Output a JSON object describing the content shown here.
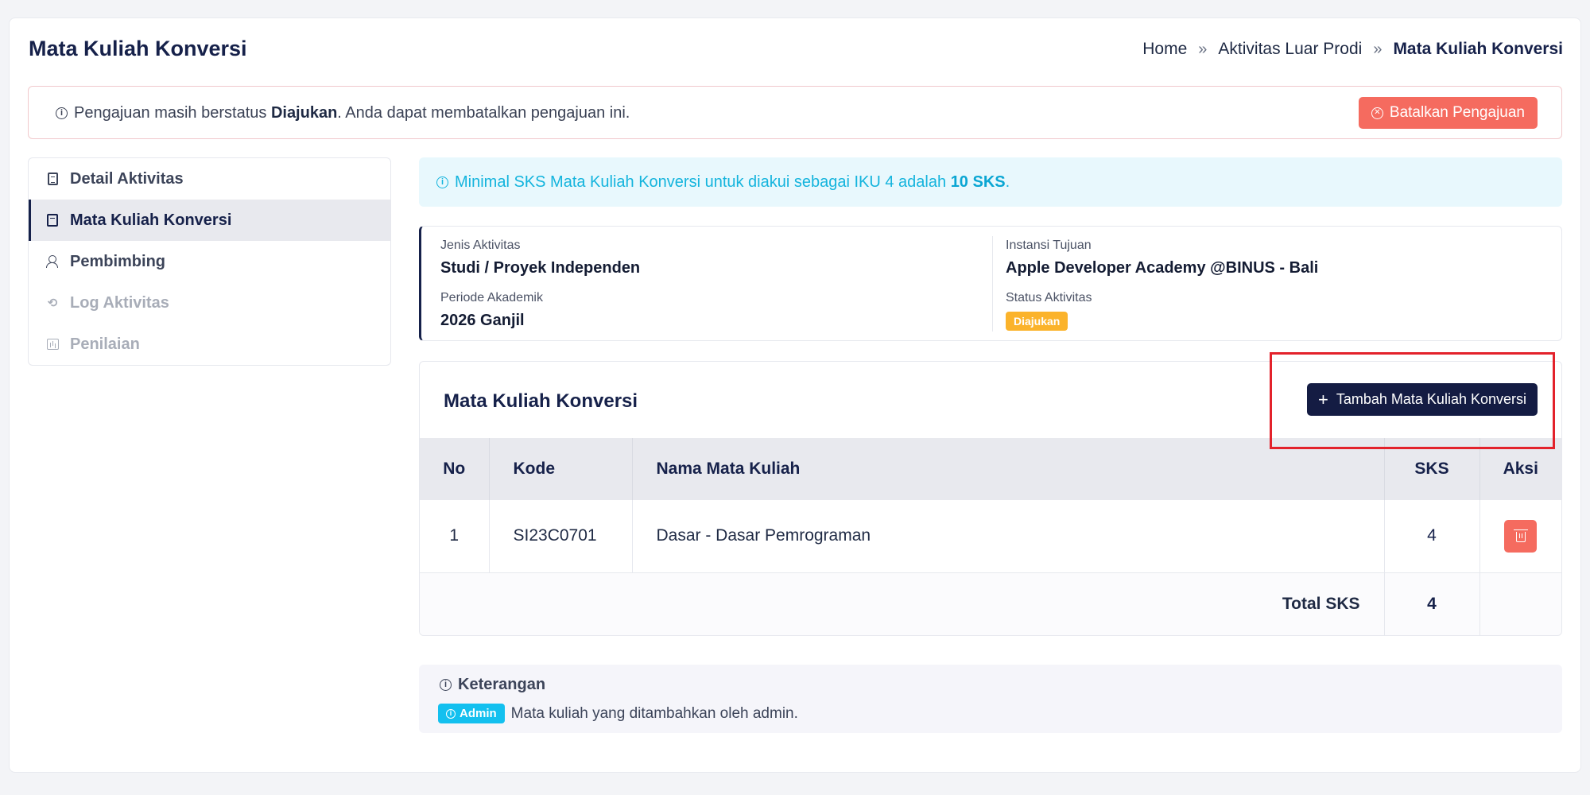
{
  "header": {
    "title": "Mata Kuliah Konversi",
    "breadcrumb": {
      "home": "Home",
      "parent": "Aktivitas Luar Prodi",
      "current": "Mata Kuliah Konversi",
      "separator": "»"
    }
  },
  "alert": {
    "prefix": "Pengajuan masih berstatus",
    "status": "Diajukan",
    "suffix": ". Anda dapat membatalkan pengajuan ini.",
    "cancel_button": "Batalkan Pengajuan"
  },
  "sidebar": {
    "items": [
      {
        "label": "Detail Aktivitas",
        "icon": "document-icon",
        "state": "normal"
      },
      {
        "label": "Mata Kuliah Konversi",
        "icon": "book-icon",
        "state": "active"
      },
      {
        "label": "Pembimbing",
        "icon": "user-icon",
        "state": "normal"
      },
      {
        "label": "Log Aktivitas",
        "icon": "history-icon",
        "state": "disabled"
      },
      {
        "label": "Penilaian",
        "icon": "chart-icon",
        "state": "disabled"
      }
    ]
  },
  "iku_info": {
    "prefix": "Minimal SKS Mata Kuliah Konversi untuk diakui sebagai IKU 4 adalah",
    "value": "10 SKS",
    "suffix": "."
  },
  "meta": {
    "jenis_label": "Jenis Aktivitas",
    "jenis_value": "Studi / Proyek Independen",
    "instansi_label": "Instansi Tujuan",
    "instansi_value": "Apple Developer Academy @BINUS - Bali",
    "periode_label": "Periode Akademik",
    "periode_value": "2026 Ganjil",
    "status_label": "Status Aktivitas",
    "status_value": "Diajukan"
  },
  "courses": {
    "title": "Mata Kuliah Konversi",
    "add_button": "Tambah Mata Kuliah Konversi",
    "columns": {
      "no": "No",
      "kode": "Kode",
      "nama": "Nama Mata Kuliah",
      "sks": "SKS",
      "aksi": "Aksi"
    },
    "rows": [
      {
        "no": "1",
        "kode": "SI23C0701",
        "nama": "Dasar - Dasar Pemrograman",
        "sks": "4"
      }
    ],
    "total_label": "Total SKS",
    "total_value": "4"
  },
  "note": {
    "title": "Keterangan",
    "badge": "Admin",
    "text": "Mata kuliah yang ditambahkan oleh admin."
  },
  "colors": {
    "primary": "#141c43",
    "danger": "#f56b5f",
    "info": "#14b4dd",
    "warning": "#fbb32b",
    "highlight": "#e3222b"
  }
}
